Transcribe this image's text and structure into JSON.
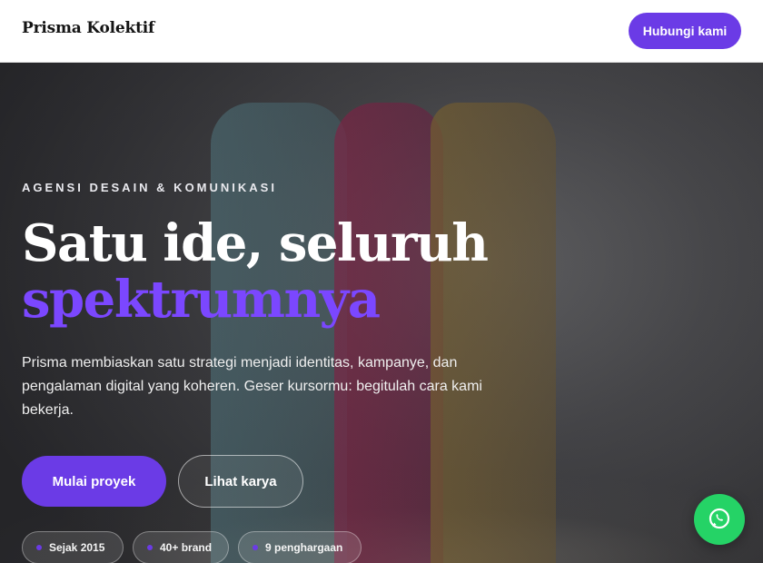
{
  "header": {
    "brand": "Prisma Kolektif",
    "contact_label": "Hubungi kami"
  },
  "hero": {
    "eyebrow": "AGENSI DESAIN & KOMUNIKASI",
    "title_line1": "Satu ide, seluruh",
    "title_line2": "spektrumnya",
    "description": "Prisma membiaskan satu strategi menjadi identitas, kampanye, dan pengalaman digital yang koheren. Geser kursormu: begitulah cara kami bekerja.",
    "primary_cta": "Mulai proyek",
    "secondary_cta": "Lihat karya",
    "badges": [
      {
        "label": "Sejak 2015"
      },
      {
        "label": "40+ brand"
      },
      {
        "label": "9 penghargaan"
      }
    ]
  },
  "floating": {
    "whatsapp_icon": "whatsapp-icon"
  },
  "colors": {
    "accent": "#6b3be6",
    "accent_text": "#7b47ff",
    "whatsapp": "#25d366",
    "header_bg": "#ffffff"
  }
}
